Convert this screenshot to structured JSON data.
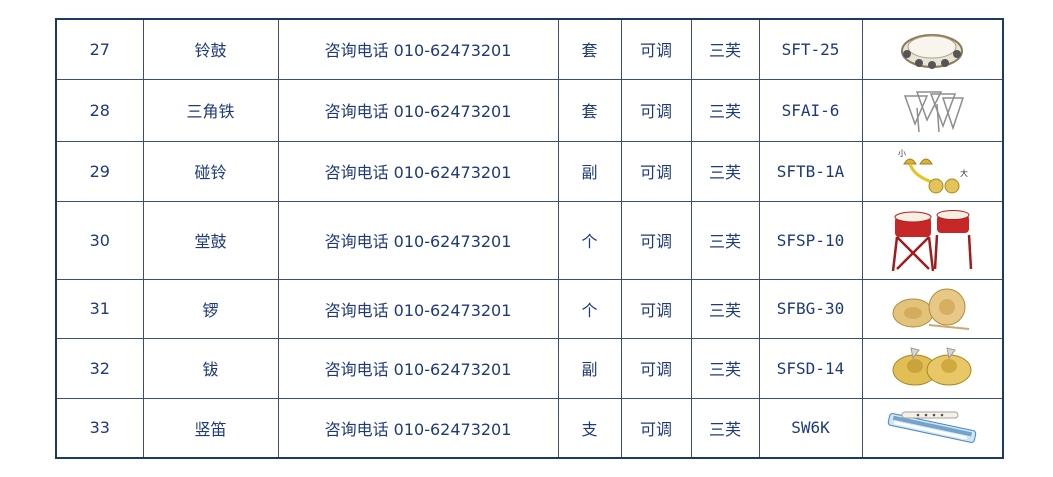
{
  "rows": [
    {
      "no": "27",
      "name": "铃鼓",
      "price": "咨询电话 010-62473201",
      "unit": "套",
      "spec": "可调",
      "brand": "三芙",
      "model": "SFT-25",
      "image_icon": "tambourine-icon"
    },
    {
      "no": "28",
      "name": "三角铁",
      "price": "咨询电话 010-62473201",
      "unit": "套",
      "spec": "可调",
      "brand": "三芙",
      "model": "SFAI-6",
      "image_icon": "triangle-instrument-icon"
    },
    {
      "no": "29",
      "name": "碰铃",
      "price": "咨询电话 010-62473201",
      "unit": "副",
      "spec": "可调",
      "brand": "三芙",
      "model": "SFTB-1A",
      "image_icon": "hand-bells-icon",
      "image_labels": [
        "小",
        "大"
      ]
    },
    {
      "no": "30",
      "name": "堂鼓",
      "price": "咨询电话 010-62473201",
      "unit": "个",
      "spec": "可调",
      "brand": "三芙",
      "model": "SFSP-10",
      "image_icon": "hall-drum-icon"
    },
    {
      "no": "31",
      "name": "锣",
      "price": "咨询电话 010-62473201",
      "unit": "个",
      "spec": "可调",
      "brand": "三芙",
      "model": "SFBG-30",
      "image_icon": "gong-icon"
    },
    {
      "no": "32",
      "name": "钹",
      "price": "咨询电话 010-62473201",
      "unit": "副",
      "spec": "可调",
      "brand": "三芙",
      "model": "SFSD-14",
      "image_icon": "cymbals-icon"
    },
    {
      "no": "33",
      "name": "竖笛",
      "price": "咨询电话 010-62473201",
      "unit": "支",
      "spec": "可调",
      "brand": "三芙",
      "model": "SW6K",
      "image_icon": "recorder-flute-icon"
    }
  ]
}
